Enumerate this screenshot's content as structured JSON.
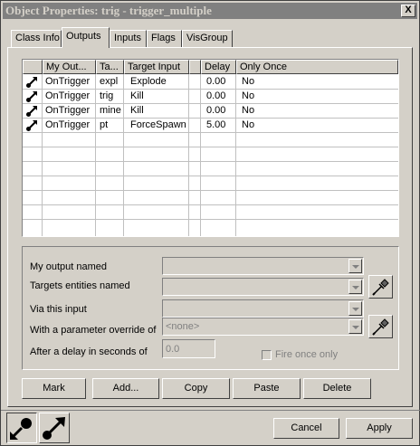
{
  "window": {
    "title": "Object Properties: trig - trigger_multiple",
    "close_label": "X"
  },
  "tabs": [
    {
      "label": "Class Info"
    },
    {
      "label": "Outputs"
    },
    {
      "label": "Inputs"
    },
    {
      "label": "Flags"
    },
    {
      "label": "VisGroup"
    }
  ],
  "outputs_list": {
    "columns": [
      "",
      "My Out...",
      "Ta...",
      "Target Input",
      "",
      "Delay",
      "Only Once"
    ],
    "rows": [
      {
        "icon": "output-arrow-icon",
        "output": "OnTrigger",
        "target": "expl",
        "input": "Explode",
        "delay": "0.00",
        "once": "No"
      },
      {
        "icon": "output-arrow-icon",
        "output": "OnTrigger",
        "target": "trig",
        "input": "Kill",
        "delay": "0.00",
        "once": "No"
      },
      {
        "icon": "output-arrow-icon",
        "output": "OnTrigger",
        "target": "mine",
        "input": "Kill",
        "delay": "0.00",
        "once": "No"
      },
      {
        "icon": "output-arrow-icon",
        "output": "OnTrigger",
        "target": "pt",
        "input": "ForceSpawn",
        "delay": "5.00",
        "once": "No"
      }
    ]
  },
  "editor": {
    "output_named_label": "My output named",
    "targets_label": "Targets entities named",
    "via_input_label": "Via this input",
    "parameter_label": "With a parameter override of",
    "parameter_value": "<none>",
    "delay_label": "After a delay in seconds of",
    "delay_value": "0.0",
    "fire_once_label": "Fire once only"
  },
  "actions": {
    "mark": "Mark",
    "add": "Add...",
    "copy": "Copy",
    "paste": "Paste",
    "delete": "Delete"
  },
  "footer": {
    "cancel": "Cancel",
    "apply": "Apply",
    "left_icon": "input-connection-icon",
    "right_icon": "output-connection-icon"
  },
  "colors": {
    "title_bg": "#808080",
    "face": "#d4d0c8",
    "list_bg": "#ffffff"
  }
}
